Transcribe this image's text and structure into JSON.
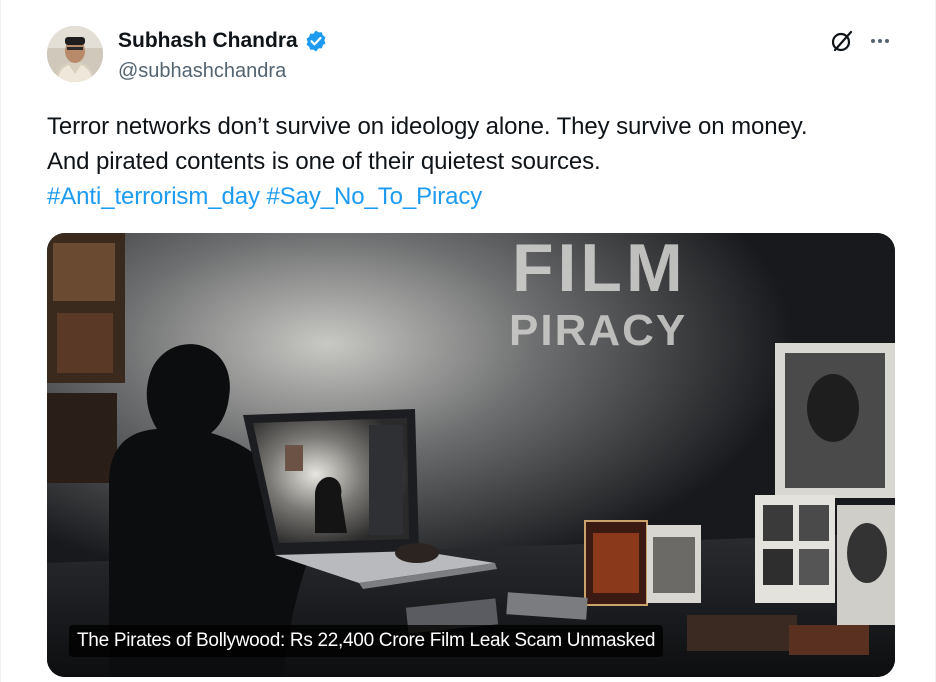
{
  "author": {
    "display_name": "Subhash Chandra",
    "handle": "@subhashchandra",
    "verified": true,
    "verified_badge_color": "#1d9bf0"
  },
  "header_actions": {
    "grok_icon": "grok-icon",
    "more_icon": "more-icon"
  },
  "tweet": {
    "line1": "Terror networks don’t survive on ideology alone. They survive on money.",
    "line2": "And pirated contents is one of their quietest sources.",
    "hashtag1": "#Anti_terrorism_day",
    "hashtag2": "#Say_No_To_Piracy"
  },
  "media": {
    "overlay_text_top": "FILM",
    "overlay_text_bottom": "PIRACY",
    "caption": "The Pirates of Bollywood: Rs 22,400 Crore Film Leak Scam Unmasked"
  },
  "colors": {
    "text": "#0f1419",
    "secondary": "#536471",
    "link": "#1d9bf0"
  }
}
